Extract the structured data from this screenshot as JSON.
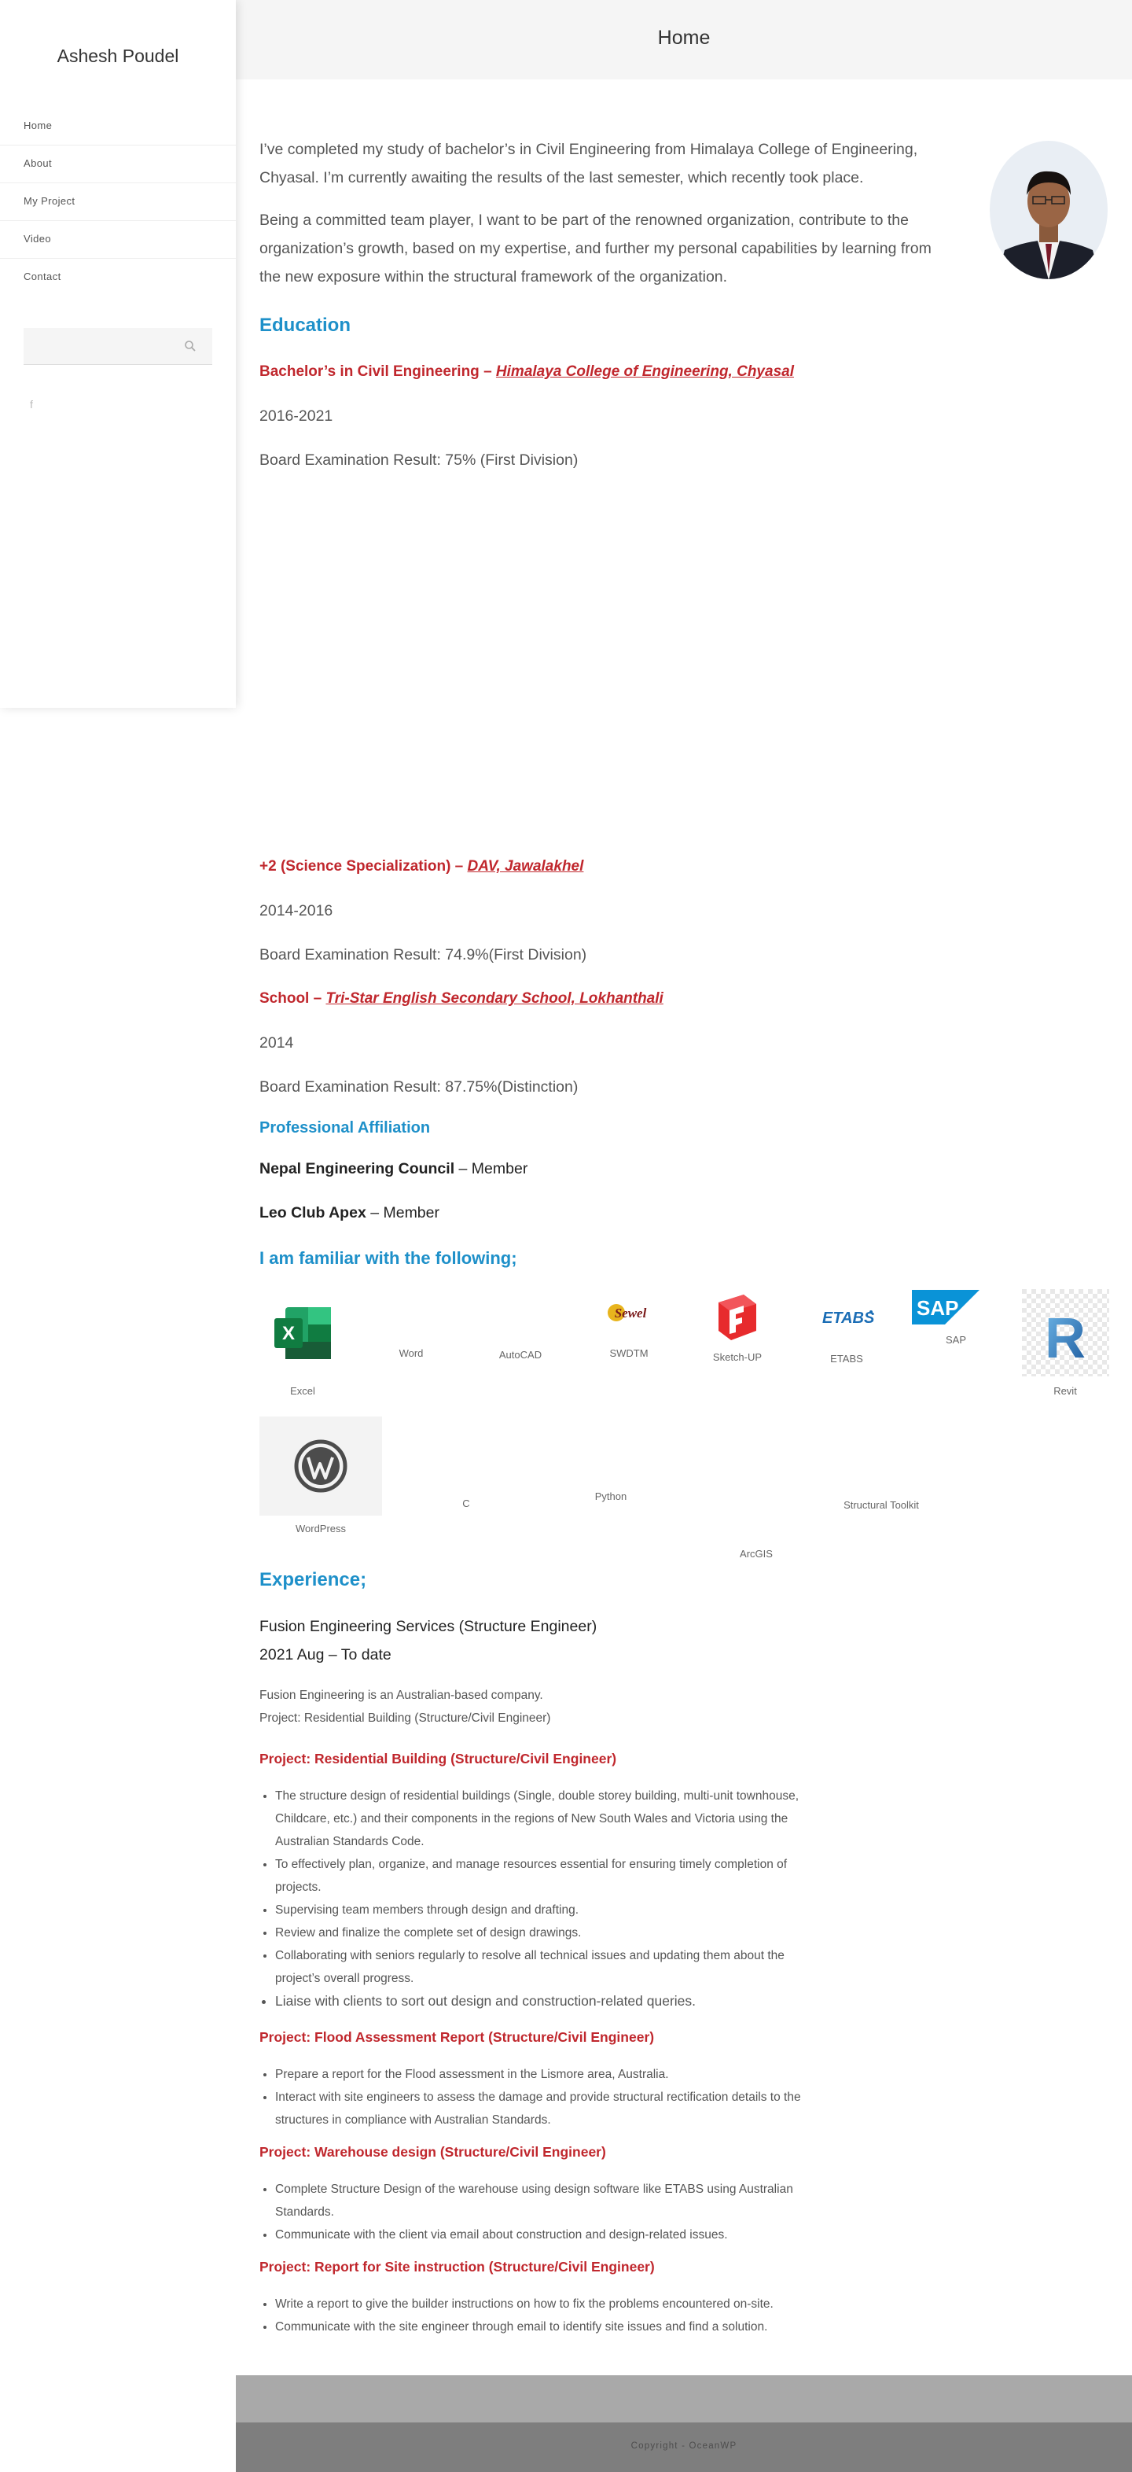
{
  "site": {
    "title": "Ashesh Poudel"
  },
  "nav": {
    "items": [
      "Home",
      "About",
      "My Project",
      "Video",
      "Contact"
    ]
  },
  "header": {
    "title": "Home"
  },
  "intro": {
    "p1": "I’ve completed my study of bachelor’s in Civil Engineering from Himalaya College of Engineering, Chyasal. I’m currently awaiting the results of the last semester, which recently took place.",
    "p2": "Being a committed team player, I want to be part of the renowned organization, contribute to the organization’s growth, based on my expertise, and further my personal capabilities by learning from the new exposure within the structural framework of the organization."
  },
  "education": {
    "heading": "Education",
    "entries": [
      {
        "prefix": "Bachelor’s in Civil Engineering – ",
        "link": "Himalaya College of Engineering, Chyasal",
        "years": "2016-2021",
        "result": "Board Examination Result: 75% (First Division)"
      },
      {
        "prefix": "+2 (Science Specialization) – ",
        "link": "DAV, Jawalakhel",
        "years": "2014-2016",
        "result": "Board Examination Result: 74.9%(First Division)"
      },
      {
        "prefix": "School – ",
        "link": "Tri-Star English Secondary School, Lokhanthali",
        "years": "2014",
        "result": "Board Examination Result: 87.75%(Distinction)"
      }
    ]
  },
  "affiliation": {
    "heading": "Professional Affiliation",
    "items": [
      {
        "org": "Nepal Engineering Council",
        "role": " – Member"
      },
      {
        "org": "Leo Club Apex",
        "role": " – Member"
      }
    ]
  },
  "tools": {
    "heading": "I am familiar with the following;",
    "labels": [
      "Excel",
      "Word",
      "AutoCAD",
      "SWDTM",
      "Sketch-UP",
      "ETABS",
      "SAP",
      "Revit",
      "WordPress",
      "C",
      "Python",
      "ArcGIS",
      "Structural Toolkit"
    ],
    "logo_text": {
      "swdtm": "Sewel",
      "etabs": "ETABS",
      "sap": "SAP",
      "excel": "X",
      "revit": "R"
    }
  },
  "experience": {
    "heading": "Experience;",
    "company": "Fusion Engineering Services (Structure Engineer)",
    "dates": "2021 Aug – To date",
    "desc1": "Fusion Engineering is an Australian-based company.",
    "desc2": "Project: Residential Building (Structure/Civil Engineer)",
    "projects": [
      {
        "title": "Project: Residential Building (Structure/Civil Engineer)",
        "bullets": [
          "The structure design of residential buildings (Single, double storey building, multi-unit townhouse, Childcare, etc.) and their components in the regions of New South Wales and Victoria using the Australian Standards Code.",
          "To effectively plan, organize, and manage resources essential for ensuring timely completion of projects.",
          "Supervising team members through design and drafting.",
          "Review and finalize the complete set of design drawings.",
          "Collaborating with seniors regularly to resolve all technical issues and updating them about the project’s overall progress.",
          "Liaise with clients to sort out design and construction-related queries."
        ]
      },
      {
        "title": "Project: Flood Assessment Report (Structure/Civil Engineer)",
        "bullets": [
          "Prepare a report for the Flood assessment in the Lismore area, Australia.",
          "Interact with site engineers to assess the damage and provide structural rectification details to the structures in compliance with Australian Standards."
        ]
      },
      {
        "title": "Project: Warehouse design (Structure/Civil Engineer)",
        "bullets": [
          "Complete Structure Design of the warehouse using design software like ETABS using Australian Standards.",
          "Communicate with the client via email about construction and design-related issues."
        ]
      },
      {
        "title": "Project: Report for Site instruction (Structure/Civil Engineer)",
        "bullets": [
          "Write a report to give the builder instructions on how to fix the problems encountered on-site.",
          "Communicate with the site engineer through email to identify site issues and find a solution."
        ]
      }
    ]
  },
  "footer": {
    "copyright": "Copyright - OceanWP"
  },
  "colors": {
    "accent_blue": "#1e90c9",
    "accent_red": "#c0272d",
    "header_bg": "#f5f5f5"
  }
}
